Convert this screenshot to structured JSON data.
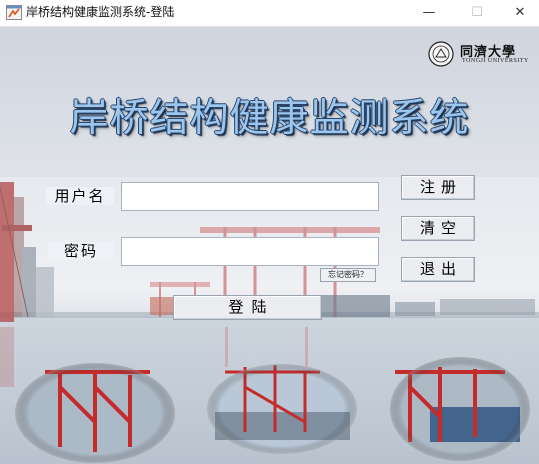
{
  "window": {
    "title": "岸桥结构健康监测系统-登陆",
    "minimize_glyph": "—",
    "maximize_glyph": "☐",
    "close_glyph": "✕"
  },
  "logo": {
    "name": "同濟大學",
    "subtitle": "TONGJI UNIVERSITY"
  },
  "header": {
    "title": "岸桥结构健康监测系统"
  },
  "form": {
    "username_label": "用户名",
    "username_value": "",
    "password_label": "密码",
    "password_value": "",
    "forgot_label": "忘记密码？",
    "login_label": "登陆"
  },
  "side_buttons": {
    "register_label": "注册",
    "clear_label": "清空",
    "exit_label": "退出"
  },
  "icons": {
    "app": "matlab-figure-icon",
    "logo": "university-seal-icon"
  }
}
